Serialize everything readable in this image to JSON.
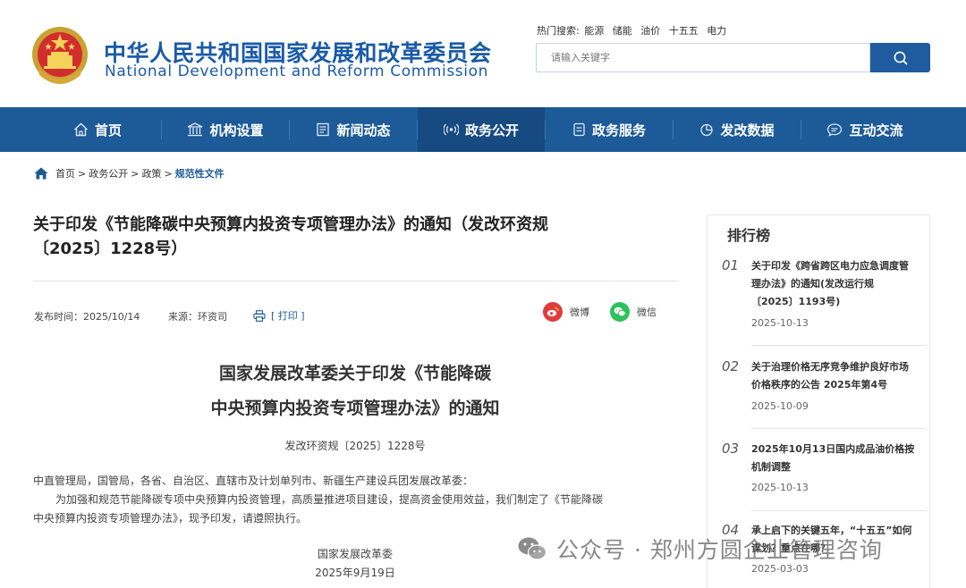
{
  "header": {
    "title_cn": "中华人民共和国国家发展和改革委员会",
    "title_en": "National Development and Reform Commission",
    "hot_search_label": "热门搜索:",
    "hot_search_terms": [
      "能源",
      "储能",
      "油价",
      "十五五",
      "电力"
    ],
    "search_placeholder": "请输入关键字",
    "colors": {
      "brand_blue": "#1a5ba8",
      "nav_blue": "#1d5a98"
    }
  },
  "nav": {
    "items": [
      {
        "label": "首页",
        "icon": "home-icon"
      },
      {
        "label": "机构设置",
        "icon": "building-icon"
      },
      {
        "label": "新闻动态",
        "icon": "news-icon"
      },
      {
        "label": "政务公开",
        "icon": "broadcast-icon",
        "active": true
      },
      {
        "label": "政务服务",
        "icon": "document-icon"
      },
      {
        "label": "发改数据",
        "icon": "pie-chart-icon"
      },
      {
        "label": "互动交流",
        "icon": "chat-icon"
      }
    ]
  },
  "breadcrumb": {
    "items": [
      "首页",
      "政务公开",
      "政策",
      "规范性文件"
    ],
    "separator": ">"
  },
  "article": {
    "title_line1": "关于印发《节能降碳中央预算内投资专项管理办法》的通知（发改环资规",
    "title_line2": "〔2025〕1228号）",
    "publish_time": "发布时间：2025/10/14",
    "source": "来源：环资司",
    "print_label": "[ 打印 ]",
    "share_weibo": "微博",
    "share_wechat": "微信",
    "doc_heading_line1": "国家发展改革委关于印发《节能降碳",
    "doc_heading_line2": "中央预算内投资专项管理办法》的通知",
    "doc_number": "发改环资规〔2025〕1228号",
    "recipients": "中直管理局，国管局，各省、自治区、直辖市及计划单列市、新疆生产建设兵团发展改革委：",
    "para_line1": "为加强和规范节能降碳专项中央预算内投资管理，高质量推进项目建设，提高资金使用效益，我们制定了《节能降碳",
    "para_line2": "中央预算内投资专项管理办法》，现予印发，请遵照执行。",
    "signature": "国家发展改革委",
    "sign_date": "2025年9月19日"
  },
  "ranking": {
    "title": "排行榜",
    "items": [
      {
        "num": "01",
        "title": "关于印发《跨省跨区电力应急调度管理办法》的通知(发改运行规〔2025〕1193号)",
        "date": "2025-10-13"
      },
      {
        "num": "02",
        "title": "关于治理价格无序竞争维护良好市场价格秩序的公告 2025年第4号",
        "date": "2025-10-09"
      },
      {
        "num": "03",
        "title": "2025年10月13日国内成品油价格按机制调整",
        "date": "2025-10-13"
      },
      {
        "num": "04",
        "title": "承上启下的关键五年，“十五五”如何谋划？重点在哪？",
        "date": "2025-03-03"
      }
    ]
  },
  "watermark": {
    "text": "公众号 · 郑州方圆企业管理咨询",
    "icon": "wechat-official-account-icon"
  }
}
